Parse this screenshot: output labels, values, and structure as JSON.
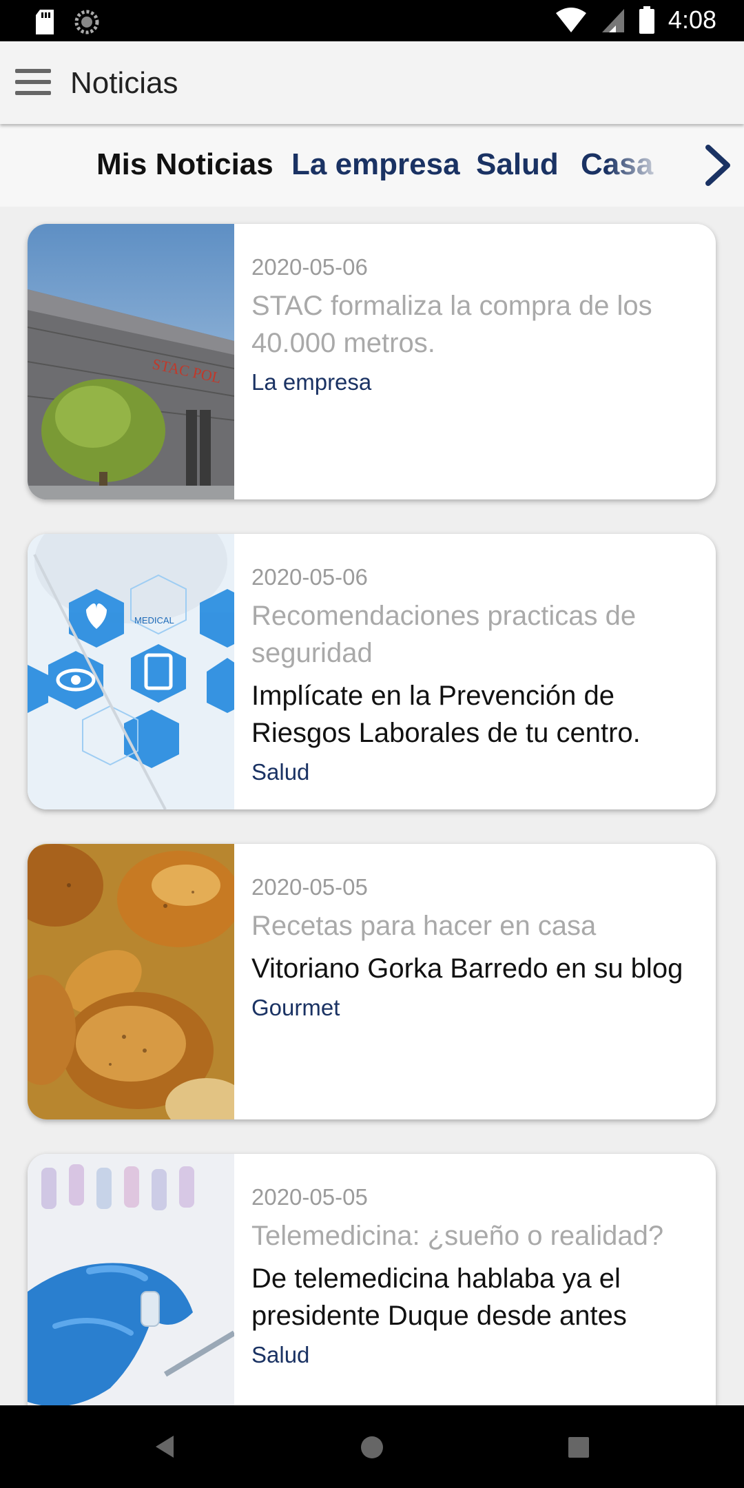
{
  "status_bar": {
    "time": "4:08",
    "icons": [
      "sd-card-icon",
      "sync-icon",
      "wifi-icon",
      "signal-icon",
      "battery-icon"
    ]
  },
  "app_bar": {
    "title": "Noticias",
    "menu_icon": "hamburger-menu-icon"
  },
  "tabs": {
    "items": [
      {
        "label": "Mis Noticias",
        "active": true
      },
      {
        "label": "La empresa",
        "active": false
      },
      {
        "label": "Salud",
        "active": false
      },
      {
        "label": "Casa",
        "active": false
      }
    ],
    "next_icon": "chevron-right-icon"
  },
  "colors": {
    "accent": "#1a3263",
    "date_text": "#9b9b9b",
    "subtitle_text": "#a9a9a9"
  },
  "articles": [
    {
      "date": "2020-05-06",
      "title": "STAC formaliza la compra de los 40.000 metros.",
      "headline": "",
      "category": "La empresa",
      "image": "building-photo",
      "image_text": "STAC POL"
    },
    {
      "date": "2020-05-06",
      "title": "Recomendaciones practicas de seguridad",
      "headline": "Implícate en la Prevención de Riesgos Laborales de tu centro.",
      "category": "Salud",
      "image": "medical-icons-photo",
      "image_text": "MEDICAL"
    },
    {
      "date": "2020-05-05",
      "title": "Recetas para hacer en casa",
      "headline": "Vitoriano Gorka Barredo en su blog",
      "category": "Gourmet",
      "image": "roast-chicken-photo"
    },
    {
      "date": "2020-05-05",
      "title": "Telemedicina: ¿sueño o realidad?",
      "headline": "De telemedicina hablaba ya el presidente Duque desde antes",
      "category": "Salud",
      "image": "lab-glove-photo"
    }
  ],
  "nav_bar": {
    "icons": [
      "back-icon",
      "home-icon",
      "recents-icon"
    ]
  }
}
